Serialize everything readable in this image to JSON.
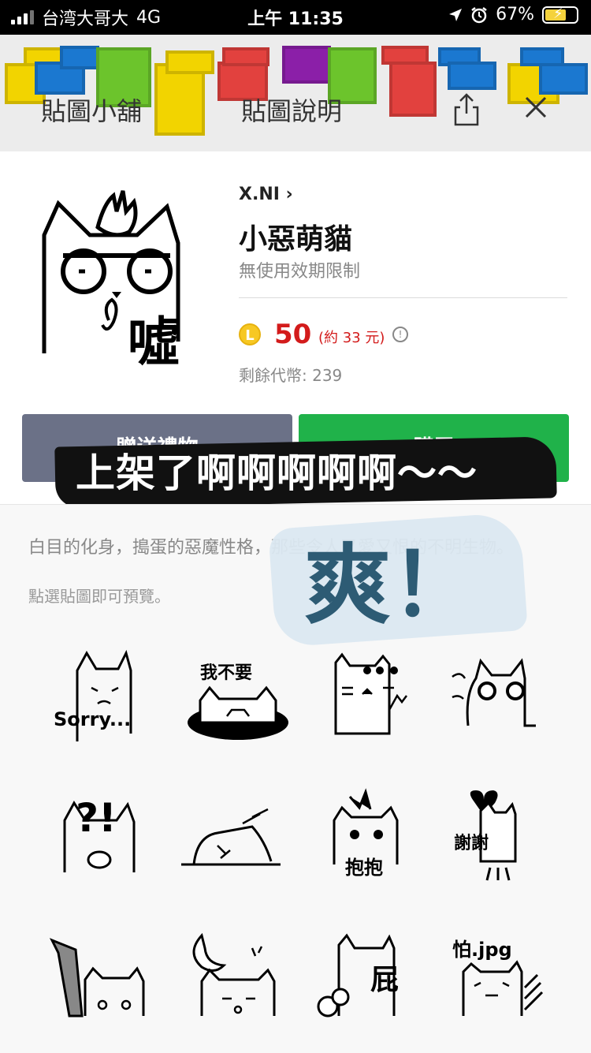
{
  "status_bar": {
    "carrier": "台湾大哥大",
    "network": "4G",
    "time": "上午 11:35",
    "battery": "67%"
  },
  "header": {
    "store_label": "貼圖小舖",
    "title": "貼圖說明"
  },
  "pack": {
    "author": "X.NI",
    "title": "小惡萌貓",
    "validity": "無使用效期限制",
    "coin_symbol": "L",
    "price": "50",
    "price_approx": "(約 33 元)",
    "coins_left": "剩餘代幣: 239",
    "main_sticker_text": "噓"
  },
  "buttons": {
    "gift": "贈送禮物",
    "buy": "購買"
  },
  "overlay": {
    "banner": "上架了啊啊啊啊啊～～",
    "exclaim": "爽！"
  },
  "description": "白目的化身，搗蛋的惡魔性格，那些令人又愛又恨的不明生物。",
  "hint": "點選貼圖即可預覽。",
  "stickers": [
    {
      "label": "Sorry..."
    },
    {
      "label": "我不要"
    },
    {
      "label": ""
    },
    {
      "label": ""
    },
    {
      "label": "?!"
    },
    {
      "label": ""
    },
    {
      "label": "抱抱"
    },
    {
      "label": "謝謝"
    },
    {
      "label": ""
    },
    {
      "label": ""
    },
    {
      "label": "屁"
    },
    {
      "label": "怕.jpg"
    }
  ]
}
